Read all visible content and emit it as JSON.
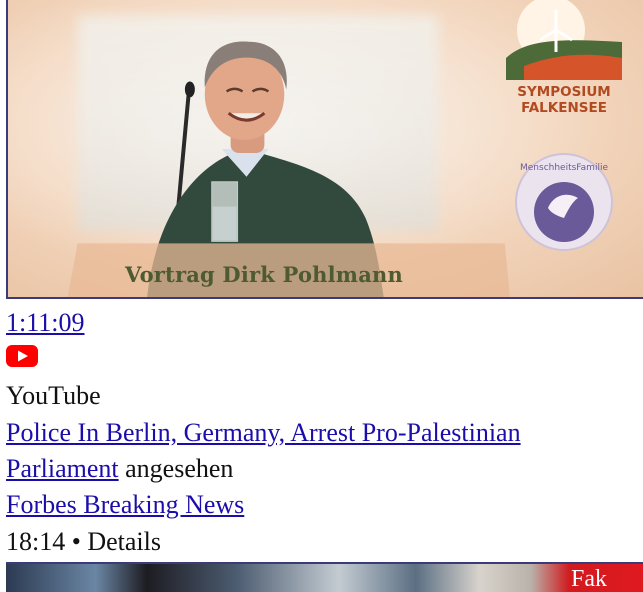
{
  "video1": {
    "duration": "1:11:09",
    "thumbnail_caption": "Vortrag Dirk Pohlmann",
    "logo_text_line1": "SYMPOSIUM",
    "logo_text_line2": "FALKENSEE",
    "badge_text": "MenschheitsFamilie",
    "source": "YouTube"
  },
  "history_item": {
    "title_line1": "Police In Berlin, Germany, Arrest Pro-Palestinian",
    "title_line2": "Parliament",
    "status": "angesehen",
    "channel": "Forbes Breaking News",
    "duration": "18:14",
    "separator": "•",
    "details_label": "Details"
  },
  "video2": {
    "thumbnail_label": "Fak"
  },
  "colors": {
    "link": "#1a0dab",
    "youtube_red": "#ff0000",
    "caption_green": "#4e5a31",
    "logo_orange": "#b24a21"
  },
  "icons": {
    "youtube": "youtube-play-icon"
  }
}
